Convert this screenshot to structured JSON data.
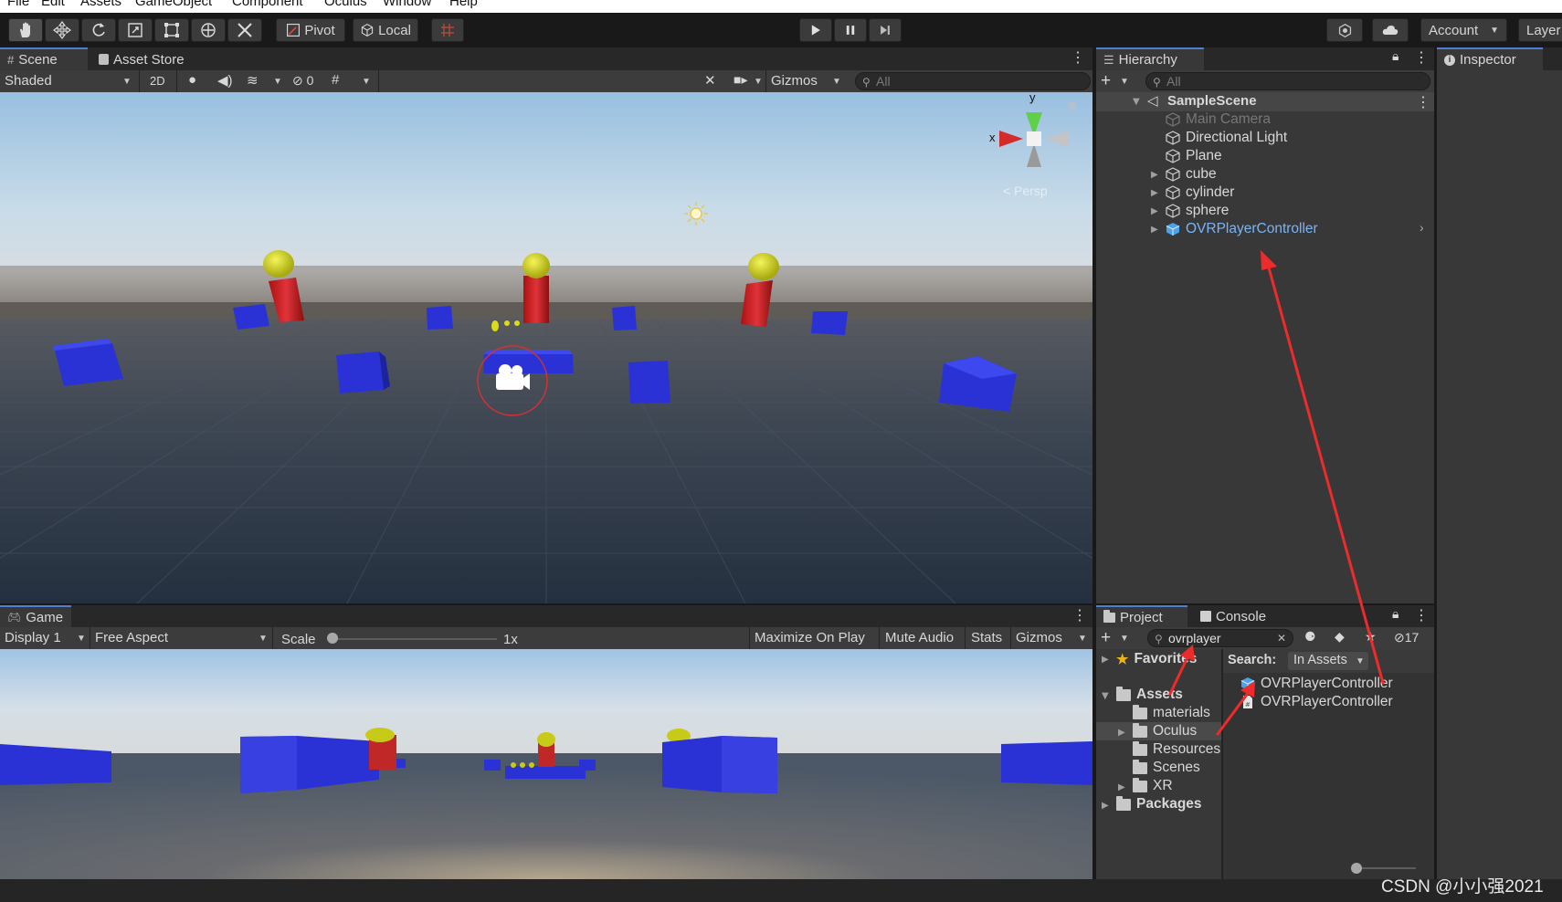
{
  "menu": [
    "File",
    "Edit",
    "Assets",
    "GameObject",
    "Component",
    "Oculus",
    "Window",
    "Help"
  ],
  "toolbar": {
    "pivot_label": "Pivot",
    "local_label": "Local",
    "account_label": "Account",
    "layers_label": "Layer"
  },
  "scene": {
    "tab_label": "Scene",
    "asset_store_label": "Asset Store",
    "shading_mode": "Shaded",
    "mode_2d": "2D",
    "hidden_count": "0",
    "gizmos_label": "Gizmos",
    "search_placeholder": "All",
    "gizmo_axis_y": "y",
    "gizmo_axis_x": "x",
    "persp_label": "< Persp"
  },
  "hierarchy": {
    "tab_label": "Hierarchy",
    "search_placeholder": "All",
    "scene_name": "SampleScene",
    "items": [
      {
        "label": "Main Camera"
      },
      {
        "label": "Directional Light"
      },
      {
        "label": "Plane"
      },
      {
        "label": "cube"
      },
      {
        "label": "cylinder"
      },
      {
        "label": "sphere"
      },
      {
        "label": "OVRPlayerController"
      }
    ]
  },
  "inspector": {
    "tab_label": "Inspector"
  },
  "game": {
    "tab_label": "Game",
    "display": "Display 1",
    "aspect": "Free Aspect",
    "scale_label": "Scale",
    "scale_value": "1x",
    "scale_fraction": 0.0,
    "maximize_label": "Maximize On Play",
    "mute_label": "Mute Audio",
    "stats_label": "Stats",
    "gizmos_label": "Gizmos"
  },
  "project": {
    "tab_label": "Project",
    "console_label": "Console",
    "search_value": "ovrplayer",
    "hidden_count": "17",
    "favorites_label": "Favorites",
    "assets_label": "Assets",
    "folders": [
      "materials",
      "Oculus",
      "Resources",
      "Scenes",
      "XR"
    ],
    "packages_label": "Packages",
    "search_scope_label": "Search:",
    "search_scope_value": "In Assets",
    "results": [
      "OVRPlayerController",
      "OVRPlayerController"
    ]
  },
  "watermark": "CSDN @小小强2021",
  "colors": {
    "accent": "#4f7fd0",
    "selected_text": "#7ab4f5",
    "annotation_red": "#ee2b2b",
    "object_blue": "#2a32d6",
    "object_red": "#d4262d",
    "sphere_yellow": "#d9dc16"
  }
}
